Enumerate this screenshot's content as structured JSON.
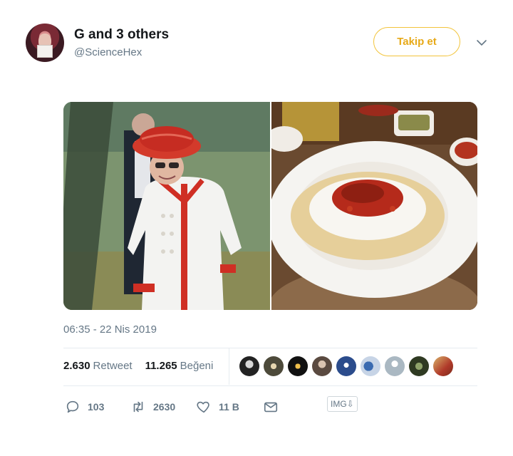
{
  "author": {
    "display_name": "G and 3 others",
    "handle": "@ScienceHex"
  },
  "follow_button": {
    "label": "Takip et"
  },
  "icons": {
    "caret": "chevron-down-icon",
    "reply": "reply-icon",
    "retweet": "retweet-icon",
    "like": "heart-icon",
    "dm": "envelope-icon"
  },
  "tweet": {
    "timestamp": "06:35 - 22 Nis 2019"
  },
  "stats": {
    "retweets_count": "2.630",
    "retweets_label": "Retweet",
    "likes_count": "11.265",
    "likes_label": "Beğeni"
  },
  "actions": {
    "reply_count": "103",
    "retweet_count": "2630",
    "like_count": "11 B"
  },
  "img_download": {
    "label": "IMG⇩"
  },
  "colors": {
    "accent": "#e7a918",
    "follow_border": "#f2c43b",
    "secondary_text": "#657786",
    "divider": "#e6ecf0"
  }
}
